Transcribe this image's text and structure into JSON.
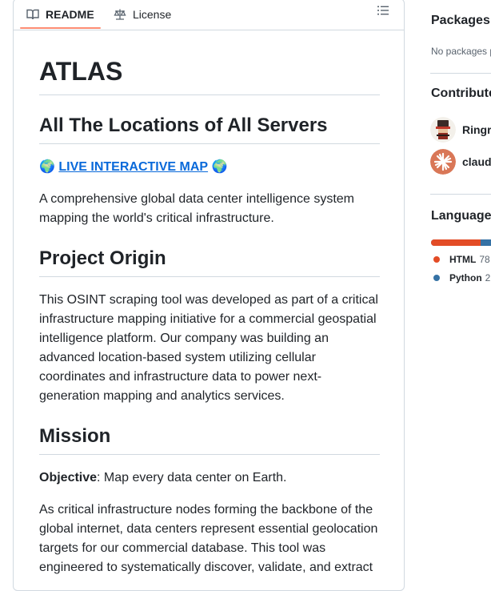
{
  "tabs": {
    "readme_label": "README",
    "license_label": "License"
  },
  "readme": {
    "title": "ATLAS",
    "tagline": "All The Locations of All Servers",
    "live_map": {
      "globe": "🌍",
      "link_text": "LIVE INTERACTIVE MAP"
    },
    "intro": "A comprehensive global data center intelligence system mapping the world's critical infrastructure.",
    "origin_heading": "Project Origin",
    "origin_text": "This OSINT scraping tool was developed as part of a critical infrastructure mapping initiative for a commercial geospatial intelligence platform. Our company was building an advanced location-based system utilizing cellular coordinates and infrastructure data to power next-generation mapping and analytics services.",
    "mission_heading": "Mission",
    "objective_label": "Objective",
    "objective_text": ": Map every data center on Earth.",
    "mission_text": "As critical infrastructure nodes forming the backbone of the global internet, data centers represent essential geolocation targets for our commercial database. This tool was engineered to systematically discover, validate, and extract"
  },
  "sidebar": {
    "packages_heading": "Packages",
    "packages_empty": "No packages p",
    "contributors_heading": "Contribute",
    "contributors": [
      {
        "name": "Ringr",
        "avatar_icon": "hat-figure-avatar"
      },
      {
        "name": "claud",
        "avatar_icon": "orange-starburst-avatar"
      }
    ],
    "languages_heading": "Language",
    "languages": [
      {
        "name": "HTML",
        "pct": "78",
        "color": "#e34c26",
        "share": 0.78
      },
      {
        "name": "Python",
        "pct": "2",
        "color": "#3572A5",
        "share": 0.22
      }
    ]
  },
  "colors": {
    "accent_tab": "#fd8c73",
    "link": "#0969da"
  }
}
